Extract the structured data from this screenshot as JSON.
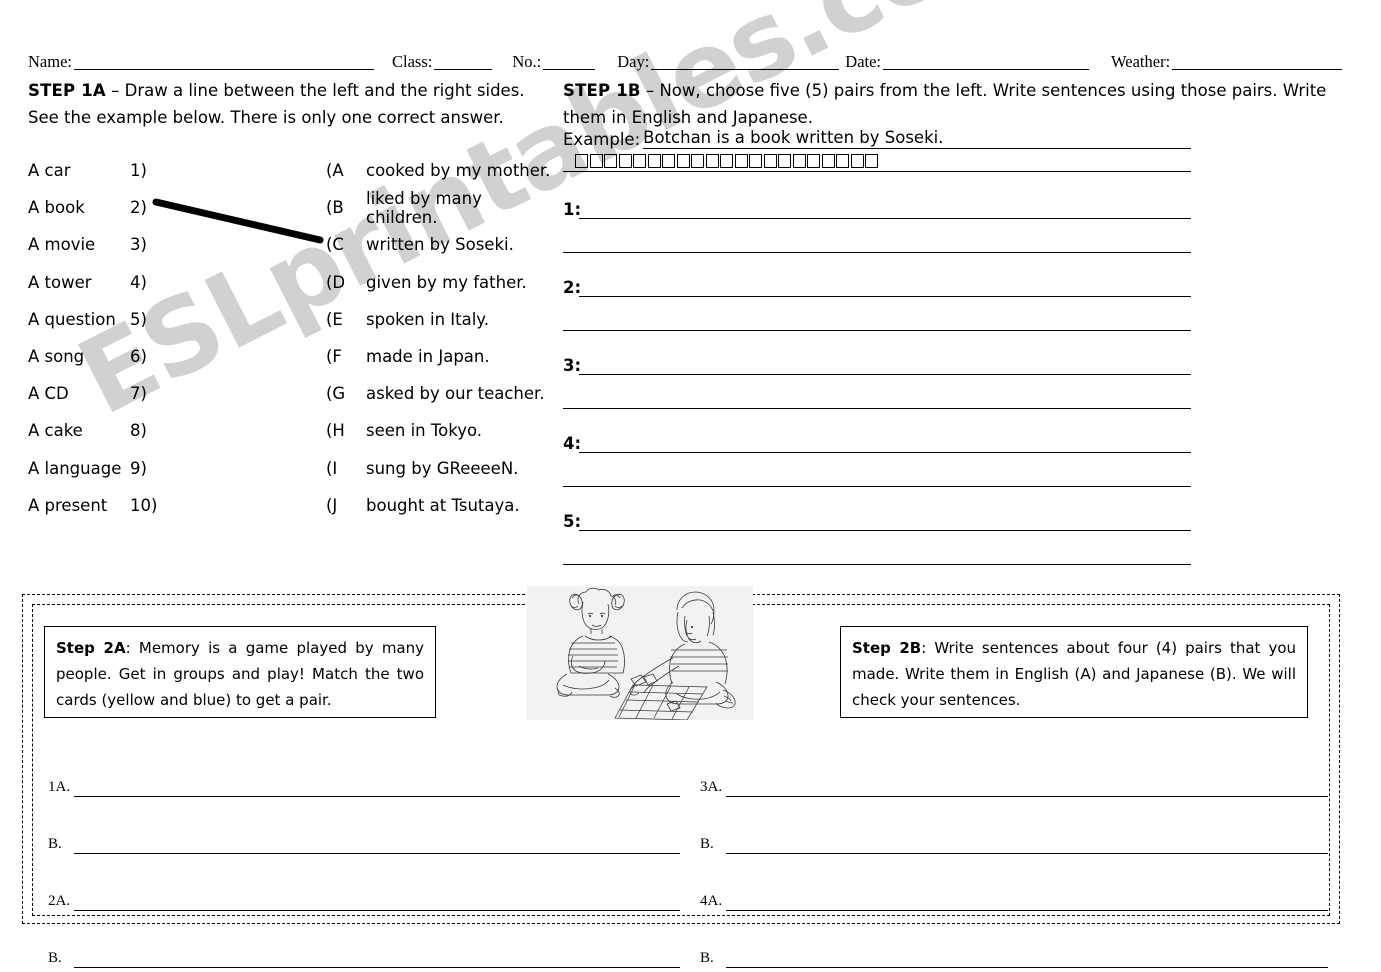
{
  "watermark": {
    "text": "ESLprintables.com"
  },
  "header": {
    "fields": [
      {
        "label": "Name:",
        "rule_width": 300
      },
      {
        "label": "Class:",
        "rule_width": 58
      },
      {
        "label": "No.:",
        "rule_width": 52
      },
      {
        "label": "Day:",
        "rule_width": 188
      },
      {
        "label": "Date:",
        "rule_width": 206
      },
      {
        "label": "Weather:",
        "rule_width": 170
      }
    ]
  },
  "step1a": {
    "title": "STEP 1A",
    "dash": " – ",
    "line1": "Draw a line between the left and the right sides.",
    "line2": "See the example below.   There is only one correct answer.",
    "left_items": [
      "A car",
      "A book",
      "A movie",
      "A tower",
      "A question",
      "A song",
      "A CD",
      "A cake",
      "A language",
      "A present"
    ],
    "numbers": [
      "1)",
      "2)",
      "3)",
      "4)",
      "5)",
      "6)",
      "7)",
      "8)",
      "9)",
      "10)"
    ],
    "letters": [
      "(A",
      "(B",
      "(C",
      "(D",
      "(E",
      "(F",
      "(G",
      "(H",
      "(I",
      "(J"
    ],
    "right_items": [
      "cooked by my mother.",
      "liked by many children.",
      "written by Soseki.",
      "given by my father.",
      "spoken in Italy.",
      "made in Japan.",
      "asked by our teacher.",
      "seen in Tokyo.",
      "sung by GReeeeN.",
      "bought at Tsutaya."
    ],
    "connector": {
      "from": "2)",
      "to": "(C"
    }
  },
  "step1b": {
    "title": "STEP 1B",
    "dash": " – ",
    "line1": "Now, choose five (5) pairs from the left.   Write sentences using those pairs.   Write",
    "line2": "them in English and Japanese.",
    "example_label": "Example:",
    "example_value": "Botchan is a book written by Soseki.",
    "example_japanese_boxes": 21,
    "answer_numbers": [
      "1:",
      "2:",
      "3:",
      "4:",
      "5:"
    ]
  },
  "step2a": {
    "title": "Step 2A",
    "colon": ": ",
    "body": "Memory is a game played by many people. Get in groups and play! Match the two cards (yellow and blue) to get a pair."
  },
  "step2b": {
    "title": "Step 2B",
    "colon": ": ",
    "body": "Write sentences about four (4) pairs that you made.   Write them in English (A) and Japanese (B). We will check your sentences."
  },
  "clipart": {
    "name": "two-children-playing-memory-card-game"
  },
  "answer_grid": {
    "left_labels": [
      "1A.",
      "B.",
      "2A.",
      "B."
    ],
    "right_labels": [
      "3A.",
      "B.",
      "4A.",
      "B."
    ]
  }
}
